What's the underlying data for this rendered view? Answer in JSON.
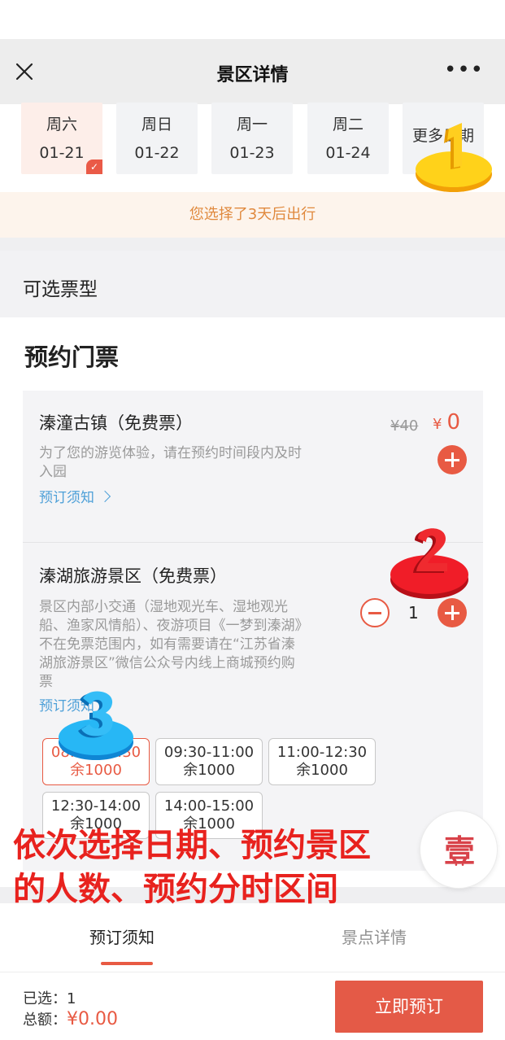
{
  "nav": {
    "title": "景区详情"
  },
  "dates": [
    {
      "weekday": "周六",
      "date": "01-21",
      "selected": true
    },
    {
      "weekday": "周日",
      "date": "01-22",
      "selected": false
    },
    {
      "weekday": "周一",
      "date": "01-23",
      "selected": false
    },
    {
      "weekday": "周二",
      "date": "01-24",
      "selected": false
    }
  ],
  "more_dates_label": "更多日期",
  "notice": "您选择了3天后出行",
  "section_title": "可选票型",
  "booking_title": "预约门票",
  "tickets": [
    {
      "name": "溱潼古镇（免费票）",
      "desc": "为了您的游览体验，请在预约时间段内及时入园",
      "link": "预订须知",
      "price_old": "¥40",
      "price_currency": "¥",
      "price_new": "0"
    },
    {
      "name": "溱湖旅游景区（免费票）",
      "desc": "景区内部小交通（湿地观光车、湿地观光船、渔家风情船）、夜游项目《一梦到溱湖》不在免票范围内，如有需要请在“江苏省溱湖旅游景区”微信公众号内线上商城预约购票",
      "link": "预订须知",
      "quantity": "1",
      "slots": [
        {
          "time": "08:00-09:30",
          "remain": "余1000",
          "selected": true
        },
        {
          "time": "09:30-11:00",
          "remain": "余1000",
          "selected": false
        },
        {
          "time": "11:00-12:30",
          "remain": "余1000",
          "selected": false
        },
        {
          "time": "12:30-14:00",
          "remain": "余1000",
          "selected": false
        },
        {
          "time": "14:00-15:00",
          "remain": "余1000",
          "selected": false
        }
      ]
    }
  ],
  "tabs": [
    "预订须知",
    "景点详情"
  ],
  "footer": {
    "selected_label": "已选：",
    "selected_count": "1",
    "total_label": "总额：",
    "total_amount": "¥0.00",
    "cta": "立即预订"
  },
  "overlay_text": "依次选择日期、预约景区的人数、预约分时区间",
  "markers": [
    "1",
    "2",
    "3"
  ],
  "colors": {
    "accent": "#e85a43",
    "link": "#4ea0d8",
    "notice": "#e0893d",
    "overlay": "#e8221e"
  }
}
